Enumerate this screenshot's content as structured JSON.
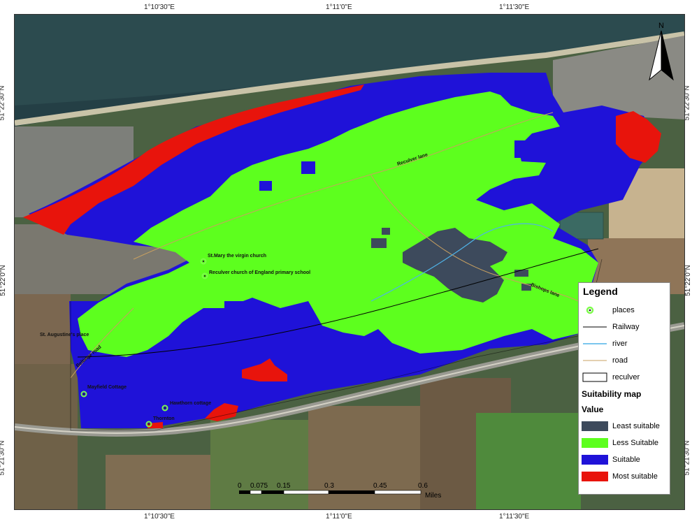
{
  "coords": {
    "top": [
      "1°10'30\"E",
      "1°11'0\"E",
      "1°11'30\"E"
    ],
    "bottom": [
      "1°10'30\"E",
      "1°11'0\"E",
      "1°11'30\"E"
    ],
    "left": [
      "51°22'30\"N",
      "51°22'0\"N",
      "51°21'30\"N"
    ],
    "right": [
      "51°22'30\"N",
      "51°22'0\"N",
      "51°21'30\"N"
    ]
  },
  "north_arrow": {
    "label": "N",
    "icon": "north-arrow-icon"
  },
  "places": [
    {
      "label": "St.Mary the virgin church"
    },
    {
      "label": "Reculver church of England primary school"
    },
    {
      "label": "St. Augustine's place"
    },
    {
      "label": "Mayfield Cottage"
    },
    {
      "label": "Hawthorn cottage"
    },
    {
      "label": "Thornton"
    }
  ],
  "roads": [
    {
      "label": "Reculver lane"
    },
    {
      "label": "Bishops lane"
    },
    {
      "label": "Beltinge road"
    }
  ],
  "legend": {
    "title": "Legend",
    "items": [
      {
        "label": "places",
        "symbol": "place-point",
        "color": "#7CFC4A"
      },
      {
        "label": "Railway",
        "symbol": "line",
        "color": "#000000"
      },
      {
        "label": "river",
        "symbol": "line",
        "color": "#4FB3E8"
      },
      {
        "label": "road",
        "symbol": "line",
        "color": "#c8a060"
      },
      {
        "label": "reculver",
        "symbol": "outline",
        "color": "#000000"
      }
    ],
    "suitability_title": "Suitability map",
    "value_title": "Value",
    "classes": [
      {
        "label": "Least suitable",
        "color": "#3d4a5c"
      },
      {
        "label": "Less Suitable",
        "color": "#5dff1e"
      },
      {
        "label": "Suitable",
        "color": "#1f12d8"
      },
      {
        "label": "Most suitable",
        "color": "#e8140c"
      }
    ]
  },
  "scale": {
    "ticks": [
      "0",
      "0.075",
      "0.15",
      "0.3",
      "0.45",
      "0.6"
    ],
    "unit": "Miles"
  }
}
